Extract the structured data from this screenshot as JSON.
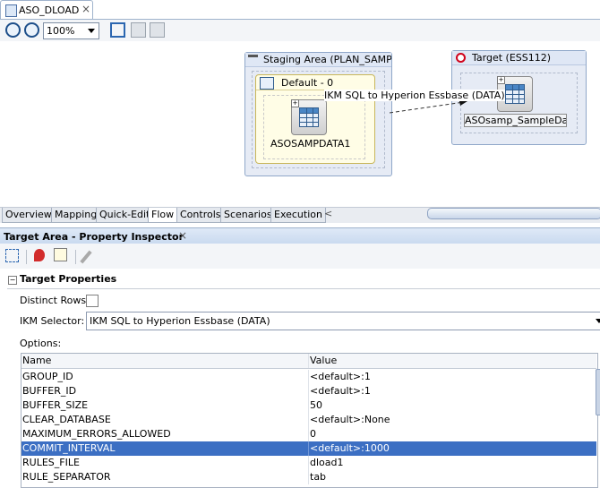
{
  "document_tab": {
    "label": "ASO_DLOAD",
    "close": "×"
  },
  "toolbar": {
    "zoom_value": "100%"
  },
  "diagram": {
    "staging_area": {
      "title": "Staging Area (PLAN_SAMP_C",
      "dataset_label": "Default - 0",
      "table_name": "ASOSAMPDATA1"
    },
    "target": {
      "title": "Target (ESS112)",
      "table_name": "ASOsamp_SampleData"
    },
    "flow_label": "IKM SQL to Hyperion Essbase (DATA)"
  },
  "view_tabs": [
    "Overview",
    "Mapping",
    "Quick-Edit",
    "Flow",
    "Controls",
    "Scenarios",
    "Execution"
  ],
  "active_view_tab": "Flow",
  "scroll_arrow": "<",
  "inspector": {
    "title": "Target Area - Property Inspector",
    "close": "×",
    "section_title": "Target Properties",
    "distinct_rows_label": "Distinct Rows:",
    "ikm_label": "IKM Selector:",
    "ikm_value": "IKM SQL to Hyperion Essbase (DATA)",
    "options_label": "Options:",
    "table_headers": [
      "Name",
      "Value"
    ],
    "options": [
      {
        "name": "GROUP_ID",
        "value": "<default>:1"
      },
      {
        "name": "BUFFER_ID",
        "value": "<default>:1"
      },
      {
        "name": "BUFFER_SIZE",
        "value": "50"
      },
      {
        "name": "CLEAR_DATABASE",
        "value": "<default>:None"
      },
      {
        "name": "MAXIMUM_ERRORS_ALLOWED",
        "value": "0"
      },
      {
        "name": "COMMIT_INTERVAL",
        "value": "<default>:1000"
      },
      {
        "name": "RULES_FILE",
        "value": "dload1"
      },
      {
        "name": "RULE_SEPARATOR",
        "value": "tab"
      }
    ],
    "selected_option": "COMMIT_INTERVAL"
  },
  "colors": {
    "selection": "#3c6fc3",
    "panel_header": "#c8d9ef",
    "target_icon": "#d0021b"
  }
}
